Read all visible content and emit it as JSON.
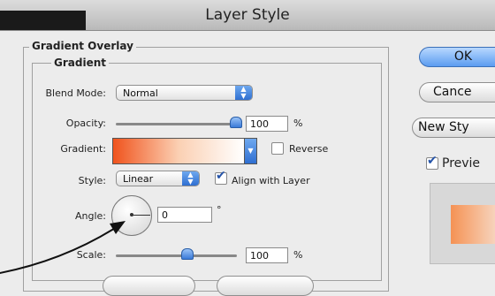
{
  "window": {
    "title": "Layer Style"
  },
  "section": {
    "title": "Gradient Overlay",
    "subtitle": "Gradient"
  },
  "blend_mode": {
    "label": "Blend Mode:",
    "value": "Normal"
  },
  "opacity": {
    "label": "Opacity:",
    "value": "100",
    "unit": "%",
    "level": 1.0
  },
  "gradient": {
    "label": "Gradient:",
    "colors": [
      "#f0531d",
      "#ffffff"
    ],
    "reverse_label": "Reverse",
    "reverse_checked": false
  },
  "style": {
    "label": "Style:",
    "value": "Linear",
    "align_label": "Align with Layer",
    "align_checked": true
  },
  "angle": {
    "label": "Angle:",
    "value": "0",
    "unit": "°"
  },
  "scale": {
    "label": "Scale:",
    "value": "100",
    "unit": "%",
    "level": 0.55
  },
  "buttons": {
    "ok": "OK",
    "cancel": "Cance",
    "new_style": "New Sty",
    "preview": "Previe",
    "preview_checked": true
  },
  "preview_swatch": {
    "colors": [
      "#f59254",
      "#f7e0d0"
    ]
  },
  "colors": {
    "accent": "#3a7ad8",
    "gradient_start": "#f0531d"
  }
}
